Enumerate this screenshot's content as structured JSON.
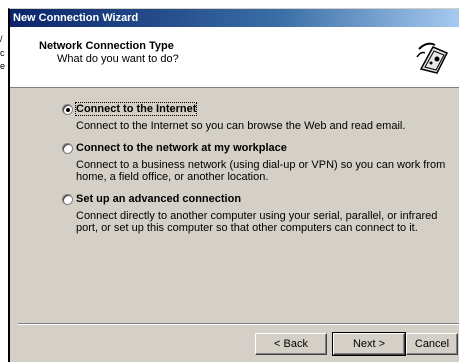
{
  "window": {
    "title": "New Connection Wizard"
  },
  "header": {
    "title": "Network Connection Type",
    "subtitle": "What do you want to do?"
  },
  "options": [
    {
      "label": "Connect to the Internet",
      "description": "Connect to the Internet so you can browse the Web and read email.",
      "selected": true
    },
    {
      "label": "Connect to the network at my workplace",
      "description": "Connect to a business network (using dial-up or VPN) so you can work from home, a field office, or another location.",
      "selected": false
    },
    {
      "label": "Set up an advanced connection",
      "description": "Connect directly to another computer using your serial, parallel, or infrared port, or set up this computer so that other computers can connect to it.",
      "selected": false
    }
  ],
  "buttons": {
    "back": "< Back",
    "next": "Next >",
    "cancel": "Cancel"
  },
  "background_fragments": [
    "/",
    "c",
    "e"
  ],
  "icon": "network-wizard-icon"
}
